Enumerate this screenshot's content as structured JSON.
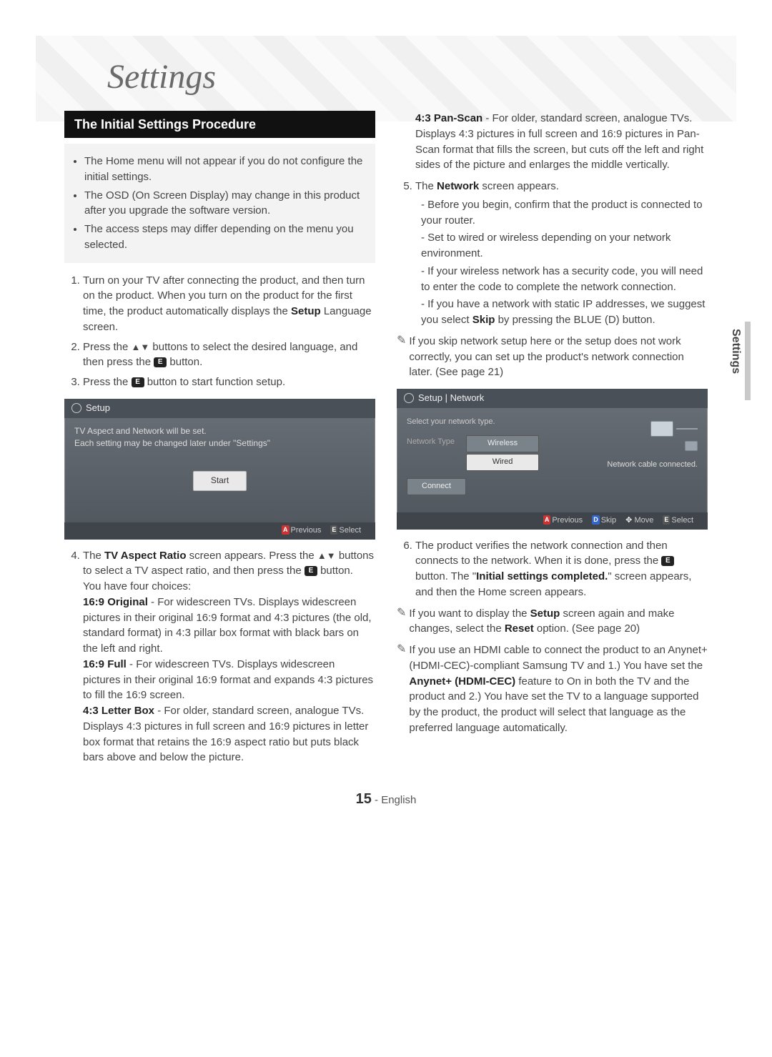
{
  "chapter_title": "Settings",
  "section_title": "The Initial Settings Procedure",
  "notes": [
    "The Home menu will not appear if you do not configure the initial settings.",
    "The OSD (On Screen Display) may change in this product after you upgrade the software version.",
    "The access steps may differ depending on the menu you selected."
  ],
  "step1": {
    "pre": "Turn on your TV after connecting the product, and then turn on the product. When you turn on the product for the first time, the product automatically displays the ",
    "bold": "Setup",
    "post": " Language screen."
  },
  "step2": {
    "a": "Press the ",
    "b": " buttons to select the desired language, and then press the ",
    "c": " button."
  },
  "step3": {
    "a": "Press the ",
    "b": " button to start function setup."
  },
  "setup_screen": {
    "title": "Setup",
    "line1": "TV Aspect and Network will be set.",
    "line2": "Each setting may be changed later under \"Settings\"",
    "start": "Start",
    "footer_prev": "Previous",
    "footer_sel": "Select"
  },
  "step4": {
    "a": "The ",
    "bold1": "TV Aspect Ratio",
    "b": " screen appears. Press the ",
    "c": " buttons to select a TV aspect ratio, and then press the ",
    "d": " button.",
    "choices_intro": "You have four choices:",
    "opt1_t": "16:9 Original",
    "opt1_b": " - For widescreen TVs. Displays widescreen pictures in their original 16:9 format and 4:3 pictures (the old, standard format) in 4:3 pillar box format with black bars on the left and right.",
    "opt2_t": "16:9 Full",
    "opt2_b": " - For widescreen TVs. Displays widescreen pictures in their original 16:9 format and expands 4:3 pictures to fill the 16:9 screen.",
    "opt3_t": "4:3 Letter Box",
    "opt3_b": " - For older, standard screen, analogue TVs. Displays 4:3 pictures in full screen and 16:9 pictures in letter box format that retains the 16:9 aspect ratio but puts black bars above and below the picture.",
    "opt4_t": "4:3 Pan-Scan",
    "opt4_b": " - For older, standard screen, analogue TVs. Displays 4:3 pictures in full screen and 16:9 pictures in Pan-Scan format that fills the screen, but cuts off the left and right sides of the picture and enlarges the middle vertically."
  },
  "step5": {
    "a": "The ",
    "bold": "Network",
    "b": " screen appears.",
    "subs": [
      "Before you begin, confirm that the product is connected to your router.",
      "Set to wired or wireless depending on your network environment.",
      "If your wireless network has a security code, you will need to enter the code to complete the network connection."
    ],
    "sub4_a": "If you have a network with static IP addresses, we suggest you select ",
    "sub4_bold": "Skip",
    "sub4_b": " by pressing the BLUE (D) button."
  },
  "note_skip": "If you skip network setup here or the setup does not work correctly, you can set up the product's network connection later. (See page 21)",
  "network_screen": {
    "title": "Setup | Network",
    "instr": "Select your network type.",
    "field": "Network Type",
    "opt_wireless": "Wireless",
    "opt_wired": "Wired",
    "connect": "Connect",
    "status": "Network cable connected.",
    "footer_prev": "Previous",
    "footer_skip": "Skip",
    "footer_move": "Move",
    "footer_sel": "Select"
  },
  "step6": {
    "a": "The product verifies the network connection and then connects to the network. When it is done, press the ",
    "b": " button. The \"",
    "bold": "Initial settings completed.",
    "c": "\" screen appears, and then the Home screen appears."
  },
  "note_reset_a": "If you want to display the ",
  "note_reset_b1": "Setup",
  "note_reset_c": " screen again and make changes, select the ",
  "note_reset_b2": "Reset",
  "note_reset_d": " option. (See page 20)",
  "note_anynet_a": "If you use an HDMI cable to connect the product to an Anynet+ (HDMI-CEC)-compliant Samsung TV and 1.) You have set the ",
  "note_anynet_b": "Anynet+ (HDMI-CEC)",
  "note_anynet_c": " feature to On in both the TV and the product and 2.) You have set the TV to a language supported by the product, the product will select that language as the preferred language automatically.",
  "side_tab": "Settings",
  "page_number": "15",
  "page_lang": " - English",
  "chips": {
    "a": "A",
    "d": "D",
    "e": "E"
  },
  "arrows": "▲▼",
  "move_glyph": "✥"
}
